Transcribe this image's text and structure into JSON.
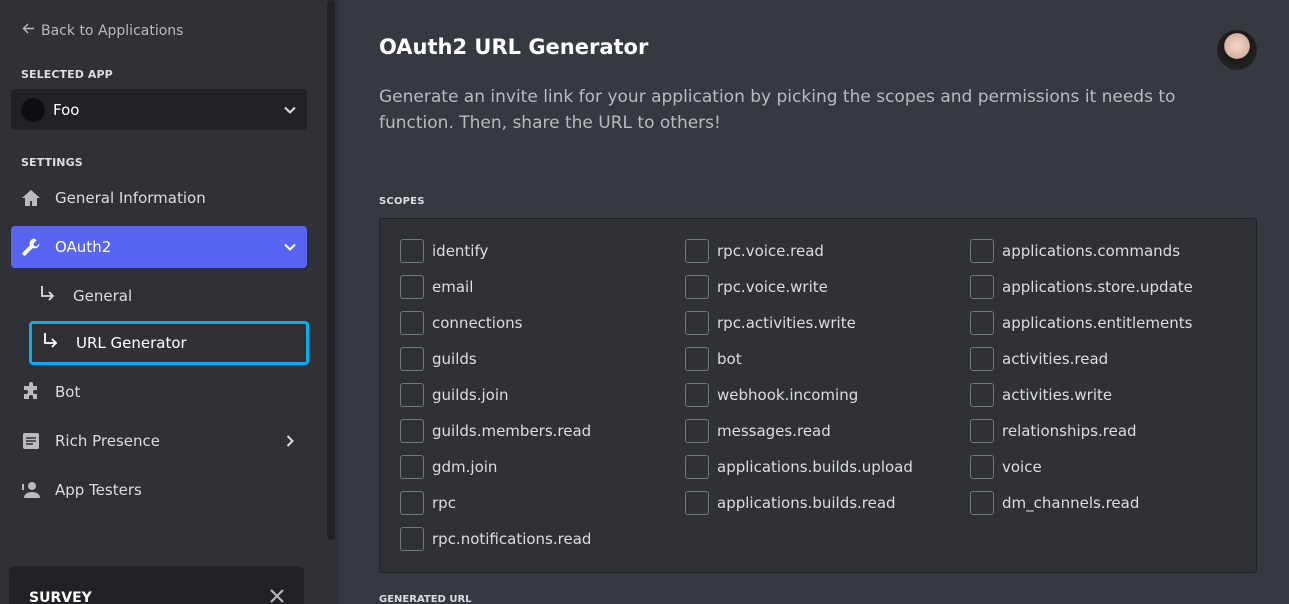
{
  "sidebar": {
    "back_label": "Back to Applications",
    "selected_app_heading": "SELECTED APP",
    "selected_app_name": "Foo",
    "settings_heading": "SETTINGS",
    "items": [
      {
        "label": "General Information",
        "icon": "home-icon"
      },
      {
        "label": "OAuth2",
        "icon": "wrench-icon"
      },
      {
        "label": "Bot",
        "icon": "puzzle-icon"
      },
      {
        "label": "Rich Presence",
        "icon": "document-icon"
      },
      {
        "label": "App Testers",
        "icon": "person-icon"
      }
    ],
    "oauth_subitems": [
      {
        "label": "General"
      },
      {
        "label": "URL Generator"
      }
    ],
    "survey_title": "SURVEY"
  },
  "main": {
    "title": "OAuth2 URL Generator",
    "description": "Generate an invite link for your application by picking the scopes and permissions it needs to function. Then, share the URL to others!",
    "scopes_heading": "SCOPES",
    "generated_heading": "GENERATED URL",
    "scopes_col1": [
      "identify",
      "email",
      "connections",
      "guilds",
      "guilds.join",
      "guilds.members.read",
      "gdm.join",
      "rpc",
      "rpc.notifications.read"
    ],
    "scopes_col2": [
      "rpc.voice.read",
      "rpc.voice.write",
      "rpc.activities.write",
      "bot",
      "webhook.incoming",
      "messages.read",
      "applications.builds.upload",
      "applications.builds.read"
    ],
    "scopes_col3": [
      "applications.commands",
      "applications.store.update",
      "applications.entitlements",
      "activities.read",
      "activities.write",
      "relationships.read",
      "voice",
      "dm_channels.read"
    ]
  },
  "colors": {
    "accent": "#5865f2",
    "focus": "#00aff4",
    "background": "#36393f",
    "sidebar": "#2f3136"
  }
}
